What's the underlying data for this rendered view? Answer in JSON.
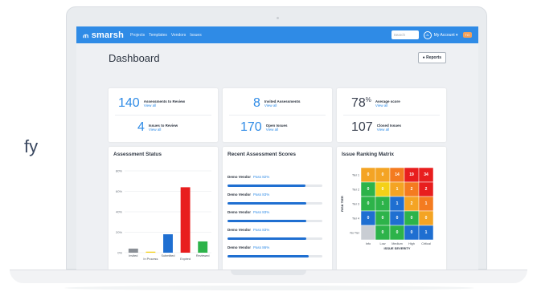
{
  "background_text": "fy",
  "nav": {
    "logo": "smarsh",
    "links": [
      "Projects",
      "Templates",
      "Vendors",
      "Issues"
    ],
    "search_placeholder": "Search",
    "avatar_initials": "JL",
    "account_label": "My Account ▾",
    "badge": "TO"
  },
  "page": {
    "title": "Dashboard",
    "reports_button": "Reports"
  },
  "stats": [
    {
      "value": "140",
      "label": "Assessments to Review",
      "link": "View all"
    },
    {
      "value": "4",
      "label": "Issues to Review",
      "link": "View all"
    },
    {
      "value": "8",
      "label": "Invited Assessments",
      "link": "View all"
    },
    {
      "value": "170",
      "label": "Open Issues",
      "link": "View all"
    },
    {
      "value": "78",
      "unit": "%",
      "label": "Average score",
      "link": "View all"
    },
    {
      "value": "107",
      "label": "Closed Issues",
      "link": "View all"
    }
  ],
  "assessment_status": {
    "title": "Assessment Status"
  },
  "recent_scores": {
    "title": "Recent Assessment Scores",
    "rows": [
      {
        "vendor": "Demo Vendor",
        "pass": "Pass 82%",
        "fill": 0.82
      },
      {
        "vendor": "Demo Vendor",
        "pass": "Pass 83%",
        "fill": 0.83
      },
      {
        "vendor": "Demo Vendor",
        "pass": "Pass 83%",
        "fill": 0.83
      },
      {
        "vendor": "Demo Vendor",
        "pass": "Pass 83%",
        "fill": 0.83
      },
      {
        "vendor": "Demo Vendor",
        "pass": "Pass 86%",
        "fill": 0.86
      }
    ]
  },
  "matrix": {
    "title": "Issue Ranking Matrix",
    "ylabel": "RISK TIER",
    "xlabel": "ISSUE SEVERITY",
    "rows": [
      "Tier 1",
      "Tier 2",
      "Tier 3",
      "Tier 4",
      "No Tier"
    ],
    "cols": [
      "Info",
      "Low",
      "Medium",
      "High",
      "Critical"
    ],
    "cells": [
      [
        {
          "v": "0",
          "c": "#f4a424"
        },
        {
          "v": "0",
          "c": "#f4a424"
        },
        {
          "v": "14",
          "c": "#f47b20"
        },
        {
          "v": "19",
          "c": "#e81e1e"
        },
        {
          "v": "34",
          "c": "#e81e1e"
        }
      ],
      [
        {
          "v": "0",
          "c": "#2db34a"
        },
        {
          "v": "0",
          "c": "#f4d118"
        },
        {
          "v": "1",
          "c": "#f4a424"
        },
        {
          "v": "2",
          "c": "#f47b20"
        },
        {
          "v": "2",
          "c": "#e81e1e"
        }
      ],
      [
        {
          "v": "0",
          "c": "#2db34a"
        },
        {
          "v": "1",
          "c": "#2db34a"
        },
        {
          "v": "1",
          "c": "#1f6fd1"
        },
        {
          "v": "2",
          "c": "#f4a424"
        },
        {
          "v": "1",
          "c": "#f47b20"
        }
      ],
      [
        {
          "v": "0",
          "c": "#1f6fd1"
        },
        {
          "v": "0",
          "c": "#2db34a"
        },
        {
          "v": "0",
          "c": "#1f6fd1"
        },
        {
          "v": "0",
          "c": "#2db34a"
        },
        {
          "v": "0",
          "c": "#f4a424"
        }
      ],
      [
        {
          "v": "",
          "c": "#c9cdd3"
        },
        {
          "v": "0",
          "c": "#2db34a"
        },
        {
          "v": "0",
          "c": "#2db34a"
        },
        {
          "v": "0",
          "c": "#1f6fd1"
        },
        {
          "v": "1",
          "c": "#1f6fd1"
        }
      ]
    ]
  },
  "chart_data": {
    "type": "bar",
    "title": "Assessment Status",
    "categories": [
      "Invited",
      "In Process",
      "Submitted",
      "Expired",
      "Reviewed"
    ],
    "values": [
      4,
      1,
      18,
      64,
      11
    ],
    "colors": [
      "#8a8f96",
      "#f4d118",
      "#1f6fd1",
      "#e81e1e",
      "#2db34a"
    ],
    "ylim": [
      0,
      80
    ],
    "yticks": [
      "0%",
      "20%",
      "40%",
      "60%",
      "80%"
    ],
    "grid": true
  }
}
